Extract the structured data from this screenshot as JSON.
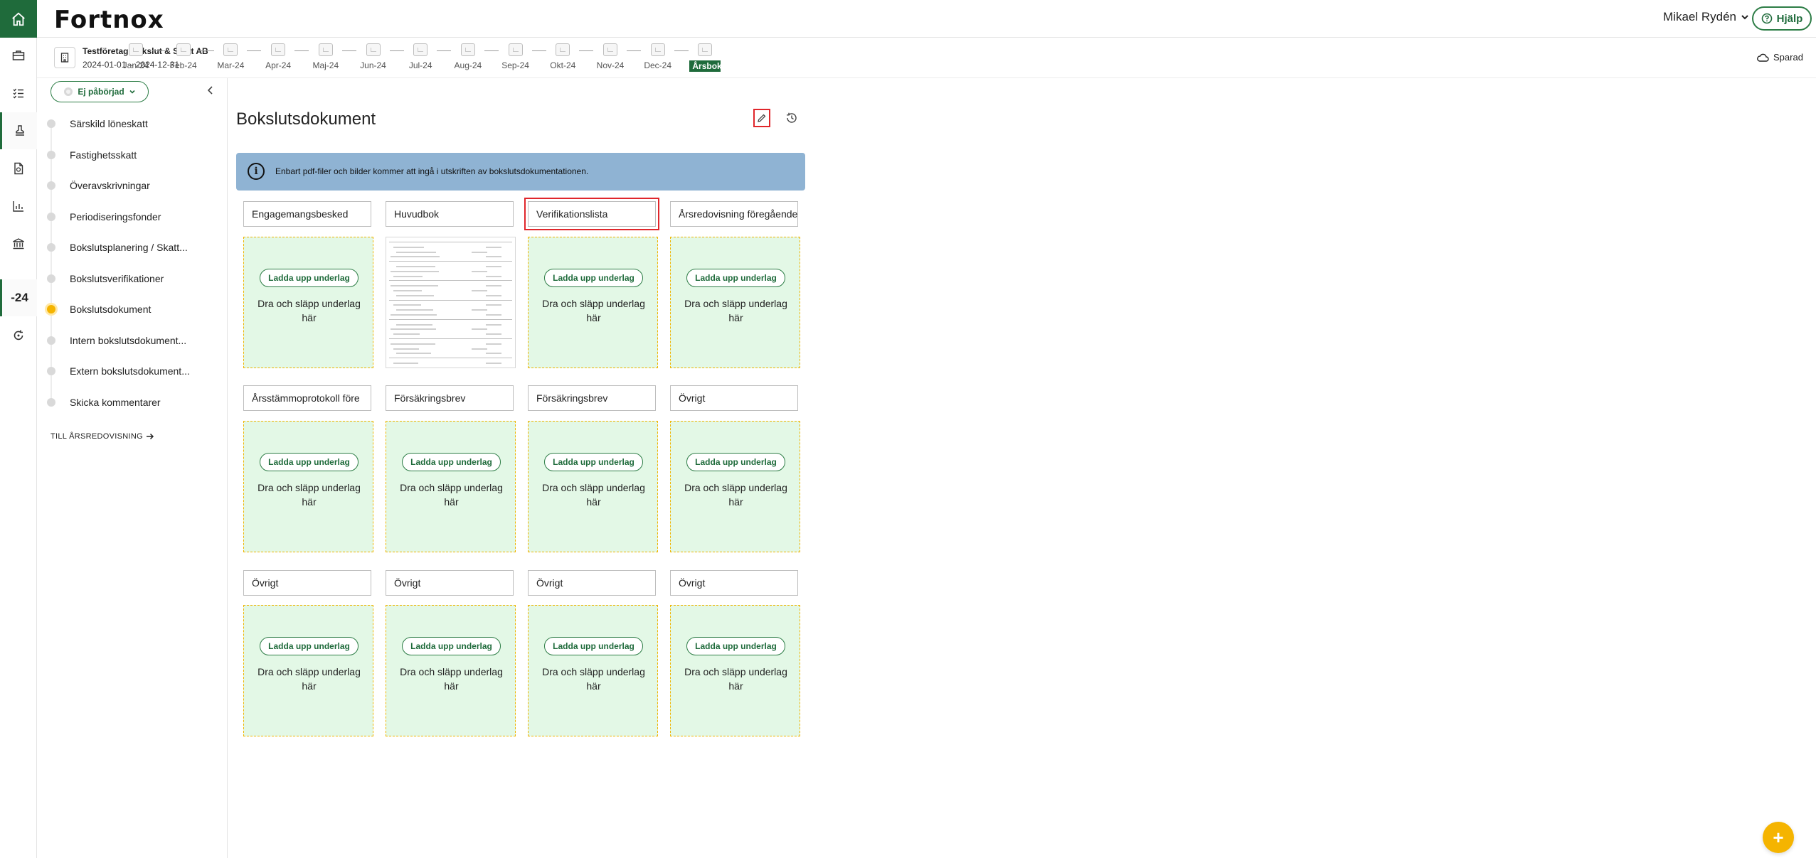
{
  "app": {
    "logo": "Fortnox"
  },
  "header": {
    "user_name": "Mikael Rydén",
    "help_label": "Hjälp"
  },
  "rail": {
    "year_label": "-24"
  },
  "company": {
    "name": "Testföretag Bokslut & Skatt AB",
    "period": "2024-01-01 – 2024-12-31"
  },
  "months": [
    "Jan-24",
    "Feb-24",
    "Mar-24",
    "Apr-24",
    "Maj-24",
    "Jun-24",
    "Jul-24",
    "Aug-24",
    "Sep-24",
    "Okt-24",
    "Nov-24",
    "Dec-24",
    "Årsbokslut"
  ],
  "saved_label": "Sparad",
  "sidebar": {
    "status": "Ej påbörjad",
    "steps": [
      {
        "label": "Särskild löneskatt"
      },
      {
        "label": "Fastighetsskatt"
      },
      {
        "label": "Överavskrivningar"
      },
      {
        "label": "Periodiseringsfonder"
      },
      {
        "label": "Bokslutsplanering / Skatt..."
      },
      {
        "label": "Bokslutsverifikationer"
      },
      {
        "label": "Bokslutsdokument"
      },
      {
        "label": "Intern bokslutsdokument..."
      },
      {
        "label": "Extern bokslutsdokument..."
      },
      {
        "label": "Skicka kommentarer"
      }
    ],
    "to_report": "TILL ÅRSREDOVISNING"
  },
  "main": {
    "title": "Bokslutsdokument",
    "info": "Enbart pdf-filer och bilder kommer att ingå i utskriften av bokslutsdokumentationen.",
    "upload_label": "Ladda upp underlag",
    "drop_text": "Dra och släpp underlag här",
    "documents": [
      {
        "title": "Engagemangsbesked"
      },
      {
        "title": "Huvudbok"
      },
      {
        "title": "Verifikationslista"
      },
      {
        "title": "Årsredovisning föregående"
      },
      {
        "title": "Årsstämmoprotokoll före"
      },
      {
        "title": "Försäkringsbrev"
      },
      {
        "title": "Försäkringsbrev"
      },
      {
        "title": "Övrigt"
      },
      {
        "title": "Övrigt"
      },
      {
        "title": "Övrigt"
      },
      {
        "title": "Övrigt"
      },
      {
        "title": "Övrigt"
      }
    ]
  },
  "colors": {
    "brand_green": "#1f6b3b",
    "accent_yellow": "#f5b400",
    "dropzone_bg": "#e3f8e6",
    "banner_blue": "#8fb3d3",
    "highlight_red": "#e0262b"
  },
  "icons": [
    "home-icon",
    "briefcase-icon",
    "list-icon",
    "stamp-icon",
    "document-icon",
    "chart-icon",
    "bank-icon",
    "refresh-icon",
    "pencil-icon",
    "history-icon",
    "info-icon",
    "cloud-icon",
    "help-icon",
    "plus-icon"
  ]
}
